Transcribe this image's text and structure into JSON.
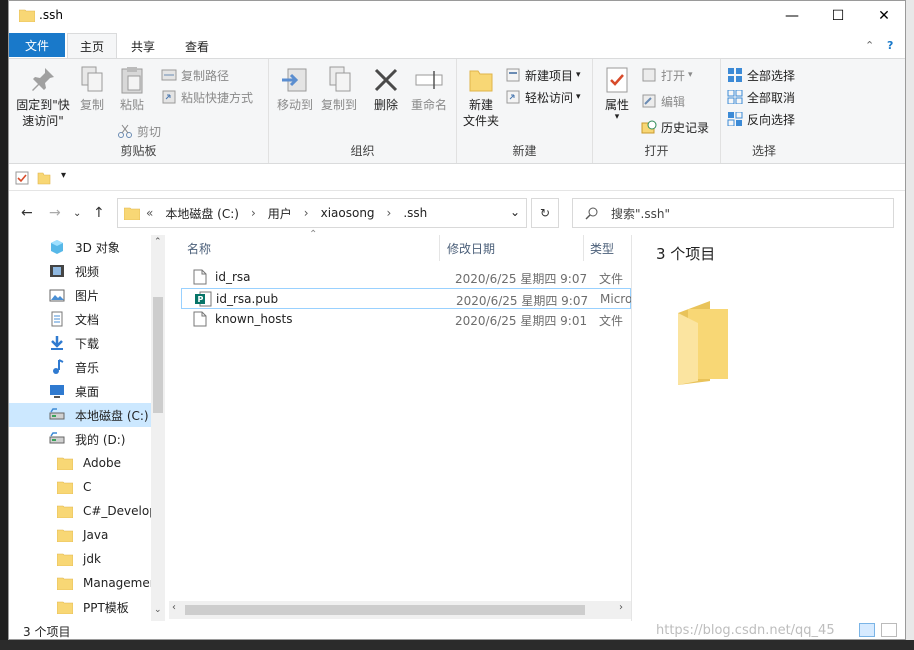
{
  "window": {
    "title": ".ssh",
    "minimize": "—",
    "maximize": "☐",
    "close": "✕"
  },
  "tabs": {
    "file": "文件",
    "home": "主页",
    "share": "共享",
    "view": "查看",
    "collapse": "⌃",
    "help": "?"
  },
  "ribbon": {
    "clipboard": {
      "label": "剪贴板",
      "pin_line1": "固定到\"快",
      "pin_line2": "速访问\"",
      "copy": "复制",
      "paste": "粘贴",
      "copy_path": "复制路径",
      "paste_shortcut": "粘贴快捷方式",
      "cut": "剪切"
    },
    "organize": {
      "label": "组织",
      "move_to": "移动到",
      "copy_to": "复制到",
      "delete": "删除",
      "rename": "重命名"
    },
    "new": {
      "label": "新建",
      "new_folder_line1": "新建",
      "new_folder_line2": "文件夹",
      "new_item": "新建项目",
      "easy_access": "轻松访问"
    },
    "open": {
      "label": "打开",
      "properties": "属性",
      "open": "打开",
      "edit": "编辑",
      "history": "历史记录"
    },
    "select": {
      "label": "选择",
      "select_all": "全部选择",
      "select_none": "全部取消",
      "invert": "反向选择"
    }
  },
  "address": {
    "chevrons": "«",
    "segments": [
      "本地磁盘 (C:)",
      "用户",
      "xiaosong",
      ".ssh"
    ],
    "separator": "›",
    "search_placeholder": "搜索\".ssh\""
  },
  "nav": {
    "items": [
      {
        "label": "3D 对象",
        "icon": "3d-objects-icon"
      },
      {
        "label": "视频",
        "icon": "video-icon"
      },
      {
        "label": "图片",
        "icon": "pictures-icon"
      },
      {
        "label": "文档",
        "icon": "documents-icon"
      },
      {
        "label": "下载",
        "icon": "download-icon"
      },
      {
        "label": "音乐",
        "icon": "music-icon"
      },
      {
        "label": "桌面",
        "icon": "desktop-icon"
      },
      {
        "label": "本地磁盘 (C:)",
        "icon": "drive-icon"
      },
      {
        "label": "我的 (D:)",
        "icon": "drive-icon"
      },
      {
        "label": "Adobe",
        "icon": "folder-icon"
      },
      {
        "label": "C",
        "icon": "folder-icon"
      },
      {
        "label": "C#_Develop",
        "icon": "folder-icon"
      },
      {
        "label": "Java",
        "icon": "folder-icon"
      },
      {
        "label": "jdk",
        "icon": "folder-icon"
      },
      {
        "label": "Managemer",
        "icon": "folder-icon"
      },
      {
        "label": "PPT模板",
        "icon": "folder-icon"
      }
    ],
    "selected_index": 7
  },
  "columns": {
    "name": "名称",
    "modified": "修改日期",
    "type": "类型"
  },
  "files": [
    {
      "name": "id_rsa",
      "modified": "2020/6/25 星期四 9:07",
      "type": "文件",
      "icon": "file-icon"
    },
    {
      "name": "id_rsa.pub",
      "modified": "2020/6/25 星期四 9:07",
      "type": "Micros",
      "icon": "publisher-file-icon"
    },
    {
      "name": "known_hosts",
      "modified": "2020/6/25 星期四 9:01",
      "type": "文件",
      "icon": "file-icon"
    }
  ],
  "preview": {
    "count": "3 个项目"
  },
  "status": {
    "count": "3 个项目"
  },
  "watermark": "https://blog.csdn.net/qq_45",
  "colors": {
    "accent": "#1979ca",
    "selection": "#cce8ff",
    "folder": "#f8d775"
  }
}
